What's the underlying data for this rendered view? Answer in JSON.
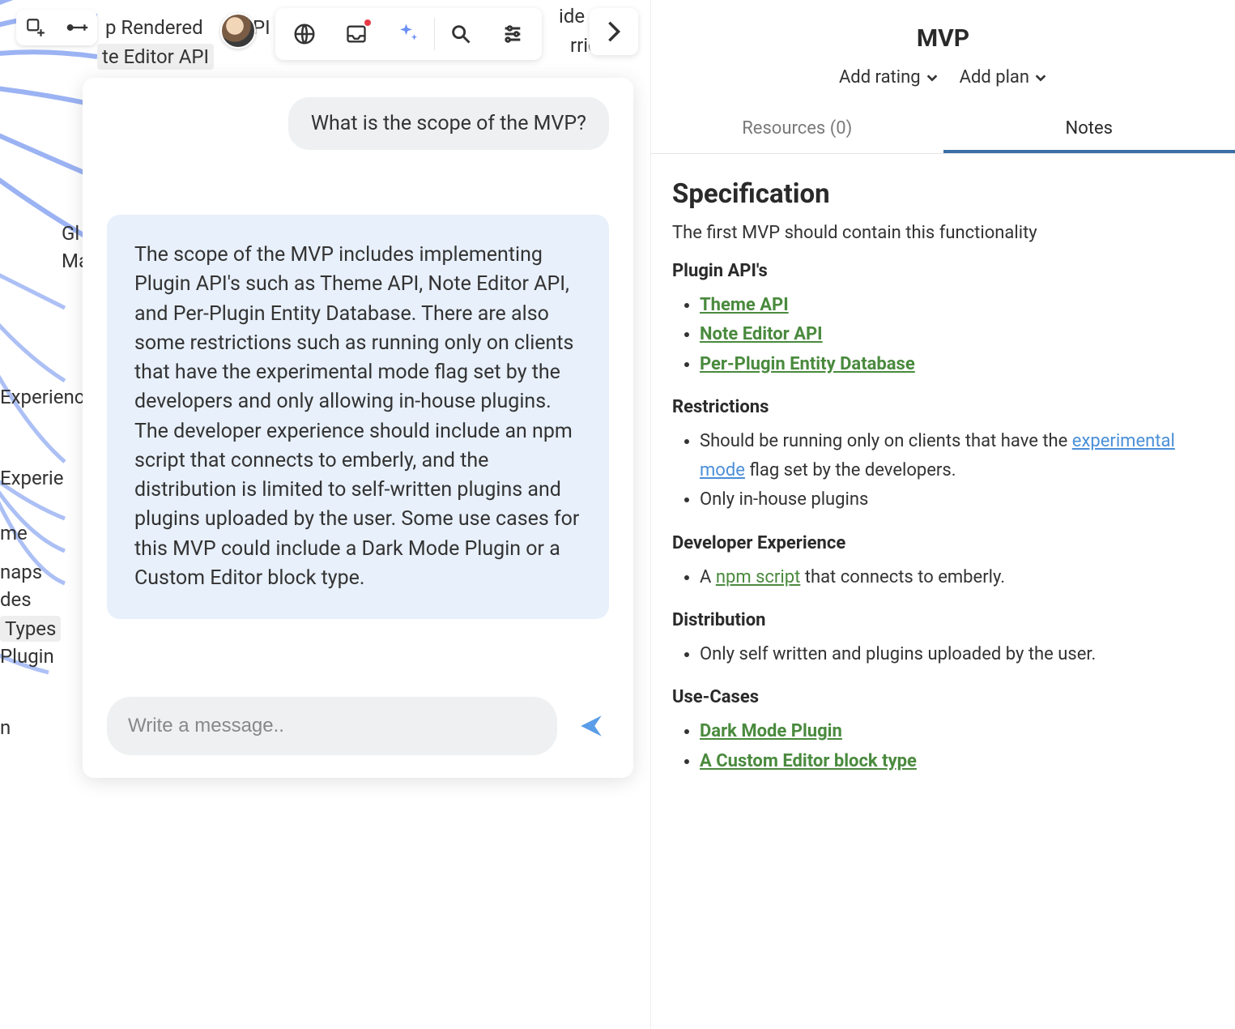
{
  "background": {
    "labels": {
      "rendered": "p Rendered",
      "editor_api": "te Editor API",
      "global": "Gl",
      "ma": "Ma",
      "experience1": "Experienc",
      "experience2": " Experie",
      "me": "me",
      "naps": "naps",
      "des": "des",
      "types": " Types",
      "plugin": " Plugin",
      "n": "n",
      "pi": "PI",
      "rric": "rric",
      "ide": "ide"
    }
  },
  "chat": {
    "user_message": "What is the scope of the MVP?",
    "ai_message": "The scope of the MVP includes implementing Plugin API's such as Theme API, Note Editor API, and Per-Plugin Entity Database. There are also some restrictions such as running only on clients that have the experimental mode flag set by the developers and only allowing in-house plugins. The developer experience should include an npm script that connects to emberly, and the distribution is limited to self-written plugins and plugins uploaded by the user. Some use cases for this MVP could include a Dark Mode Plugin or a Custom Editor block type.",
    "input_placeholder": "Write a message.."
  },
  "sidebar": {
    "title": "MVP",
    "add_rating": "Add rating",
    "add_plan": "Add plan",
    "tabs": {
      "resources": "Resources (0)",
      "notes": "Notes"
    },
    "spec_heading": "Specification",
    "spec_sub": "The first MVP should contain this functionality",
    "h_plugin_apis": "Plugin API's",
    "links": {
      "theme_api": "Theme API",
      "note_editor_api": "Note Editor API",
      "per_plugin_db": "Per-Plugin Entity Database",
      "experimental_mode": "experimental mode",
      "npm_script": "npm script",
      "dark_mode_plugin": "Dark Mode Plugin",
      "custom_editor_block": "A Custom Editor block type"
    },
    "h_restrictions": "Restrictions",
    "restr_1_pre": "Should be running only on clients that have the ",
    "restr_1_post": " flag set by the developers.",
    "restr_2": "Only in-house plugins",
    "h_devexp": "Developer Experience",
    "devexp_pre": "A ",
    "devexp_post": " that connects to emberly.",
    "h_distribution": "Distribution",
    "distribution_1": "Only self written and plugins uploaded by the user.",
    "h_usecases": "Use-Cases"
  }
}
